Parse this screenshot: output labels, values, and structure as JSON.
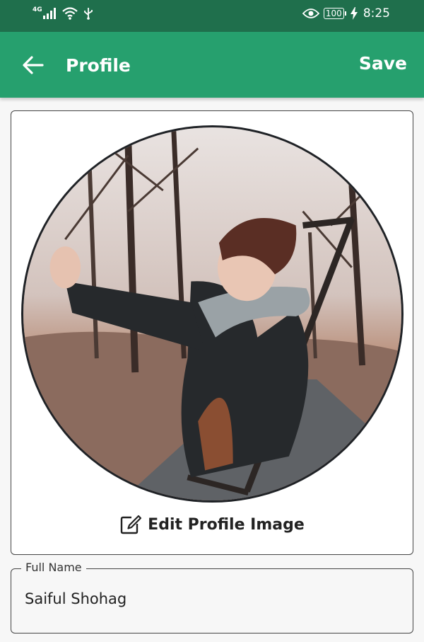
{
  "status_bar": {
    "network": "4G",
    "battery": "100",
    "time": "8:25",
    "icons": [
      "signal-icon",
      "wifi-icon",
      "usb-icon",
      "eye-icon",
      "battery-icon",
      "charging-icon"
    ]
  },
  "app_bar": {
    "title": "Profile",
    "save_label": "Save",
    "back_icon": "arrow-left-icon"
  },
  "profile_image": {
    "edit_label": "Edit Profile Image",
    "edit_icon": "edit-icon"
  },
  "full_name": {
    "label": "Full Name",
    "value": "Saiful Shohag"
  },
  "colors": {
    "status_bar": "#1f6f4c",
    "app_bar": "#26a06e",
    "background": "#f7f7f7",
    "border": "#444444"
  }
}
